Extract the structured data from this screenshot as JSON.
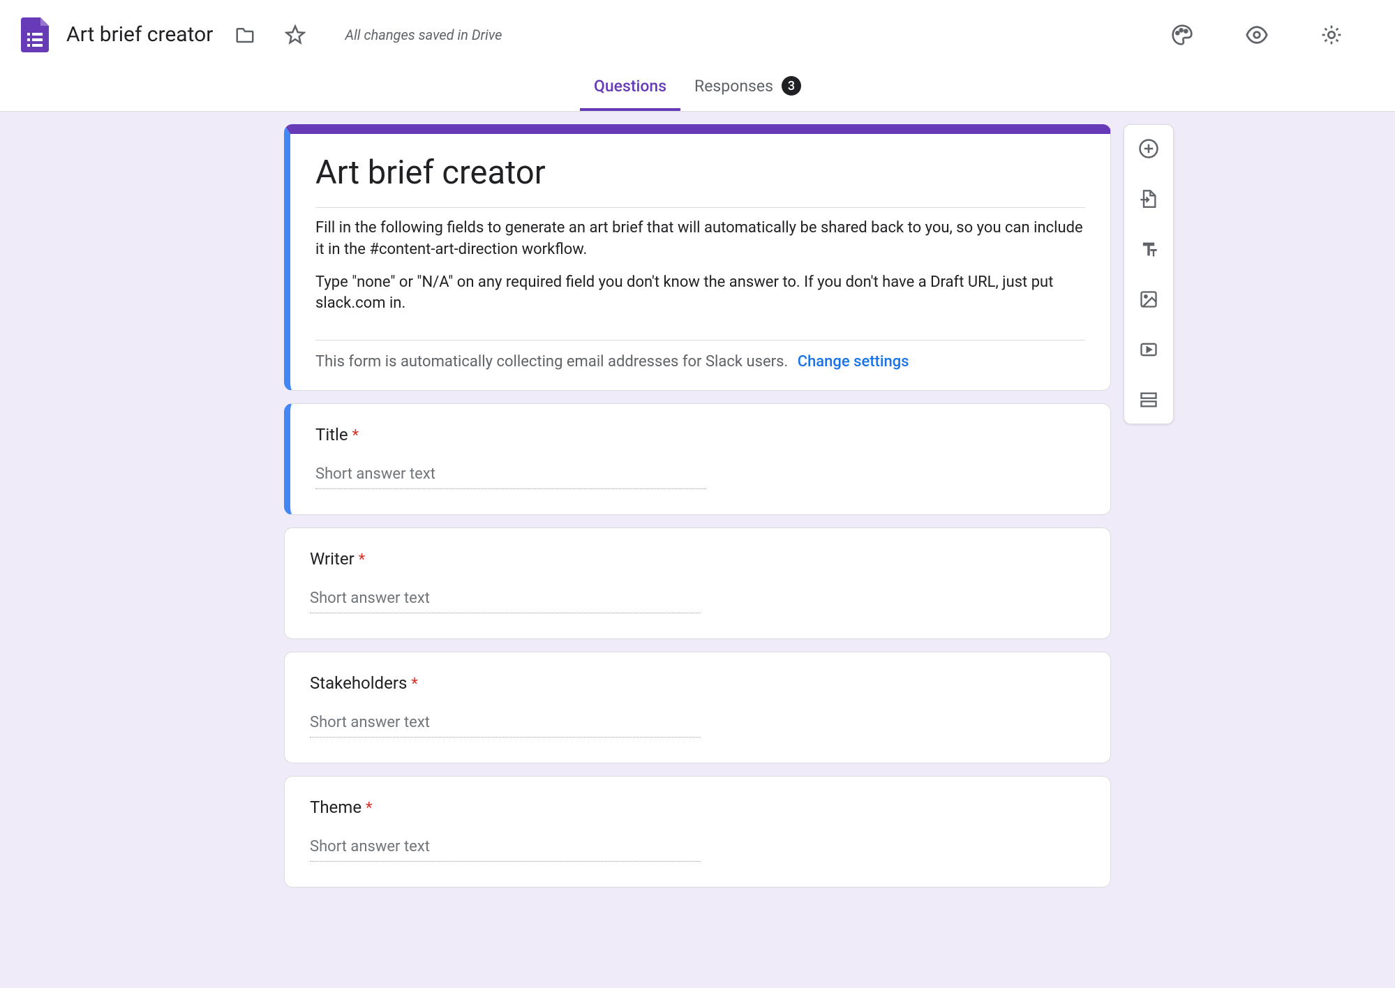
{
  "header": {
    "doc_title": "Art brief creator",
    "save_status": "All changes saved in Drive"
  },
  "tabs": {
    "questions": "Questions",
    "responses": "Responses",
    "responses_count": "3"
  },
  "form": {
    "title": "Art brief creator",
    "description_p1": "Fill in the following fields to generate an art brief that will automatically be shared back to you, so you can include it in the #content-art-direction workflow.",
    "description_p2": "Type \"none\" or \"N/A\" on any required field you don't know the answer to. If you don't have a Draft URL, just put slack.com in.",
    "email_notice": "This form is automatically collecting email addresses for Slack users.",
    "change_settings": "Change settings"
  },
  "questions": [
    {
      "label": "Title",
      "required": true,
      "placeholder": "Short answer text"
    },
    {
      "label": "Writer",
      "required": true,
      "placeholder": "Short answer text"
    },
    {
      "label": "Stakeholders",
      "required": true,
      "placeholder": "Short answer text"
    },
    {
      "label": "Theme",
      "required": true,
      "placeholder": "Short answer text"
    }
  ]
}
